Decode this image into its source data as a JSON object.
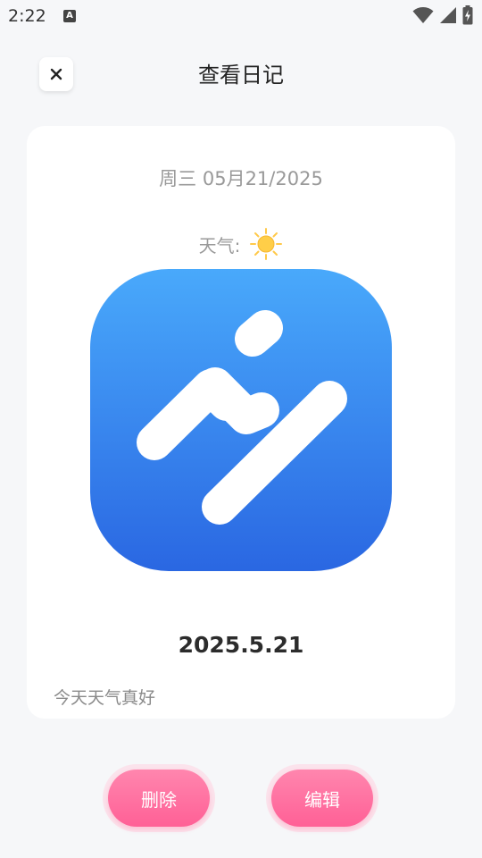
{
  "status_bar": {
    "time": "2:22",
    "indicator_letter": "A"
  },
  "header": {
    "title": "查看日记",
    "close_symbol": "✕"
  },
  "diary": {
    "date": "周三 05月21/2025",
    "weather_label": "天气:",
    "weather_icon": "sun-icon",
    "title": "2025.5.21",
    "content": "今天天气真好"
  },
  "actions": {
    "delete_label": "删除",
    "edit_label": "编辑"
  },
  "colors": {
    "accent_pink": "#ff6f9f",
    "image_gradient_top": "#49a9fb",
    "image_gradient_bottom": "#2a67e2",
    "sun": "#ffce48"
  }
}
